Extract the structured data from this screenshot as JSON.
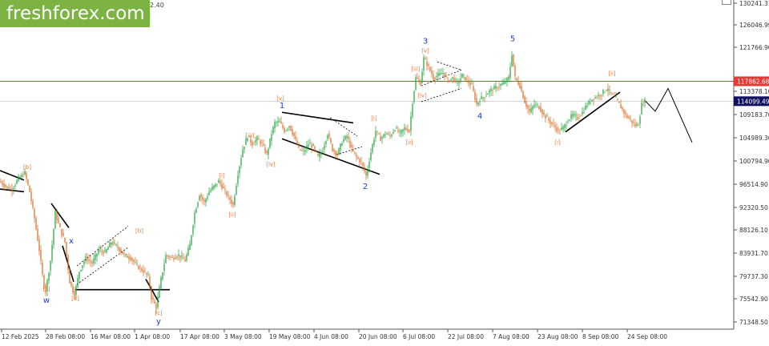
{
  "brand": {
    "logo_text": "freshforex.com",
    "color": "#7cb342"
  },
  "header_fragment": "2.40",
  "colors": {
    "up": "#1e9e3a",
    "down": "#d2691e",
    "hline": "#e53935",
    "wave_blue": "#1a3fc4",
    "wave_orange": "#e07b39",
    "axis": "#333333"
  },
  "chart_data": {
    "type": "candlestick",
    "title": "",
    "ylim": [
      71348.5,
      132000
    ],
    "y_ticks": [
      "130241.31",
      "126046.99",
      "121766.90",
      "117862.68",
      "113378.10",
      "109183.70",
      "104989.30",
      "100794.90",
      "96514.90",
      "92320.50",
      "88126.10",
      "83931.70",
      "79737.30",
      "75542.90",
      "71348.50"
    ],
    "x_ticks": [
      "12 Feb 2025",
      "28 Feb 08:00",
      "16 Mar 08:00",
      "1 Apr 08:00",
      "17 Apr 08:00",
      "3 May 08:00",
      "19 May 08:00",
      "4 Jun 08:00",
      "20 Jun 08:00",
      "6 Jul 08:00",
      "22 Jul 08:00",
      "7 Aug 08:00",
      "23 Aug 08:00",
      "8 Sep 08:00",
      "24 Sep 08:00"
    ],
    "resistance_level": {
      "value": 117862.68,
      "label": "117862.68"
    },
    "current_price": {
      "value": 114099.49,
      "label": "114099.49"
    },
    "path": [
      [
        0,
        99000
      ],
      [
        8,
        98000
      ],
      [
        16,
        97500
      ],
      [
        24,
        99500
      ],
      [
        32,
        100500
      ],
      [
        38,
        97000
      ],
      [
        44,
        92000
      ],
      [
        50,
        86000
      ],
      [
        55,
        80000
      ],
      [
        58,
        78200
      ],
      [
        64,
        84000
      ],
      [
        70,
        93000
      ],
      [
        76,
        90000
      ],
      [
        82,
        87500
      ],
      [
        88,
        80000
      ],
      [
        94,
        77500
      ],
      [
        100,
        82000
      ],
      [
        108,
        84500
      ],
      [
        116,
        83500
      ],
      [
        124,
        86000
      ],
      [
        132,
        85500
      ],
      [
        140,
        87500
      ],
      [
        148,
        86500
      ],
      [
        156,
        85000
      ],
      [
        164,
        84500
      ],
      [
        172,
        83000
      ],
      [
        180,
        82000
      ],
      [
        186,
        81000
      ],
      [
        190,
        77000
      ],
      [
        196,
        75200
      ],
      [
        202,
        80500
      ],
      [
        208,
        85000
      ],
      [
        216,
        84500
      ],
      [
        224,
        85000
      ],
      [
        232,
        84000
      ],
      [
        238,
        87000
      ],
      [
        244,
        93000
      ],
      [
        250,
        96500
      ],
      [
        256,
        95000
      ],
      [
        262,
        97000
      ],
      [
        268,
        98000
      ],
      [
        274,
        99000
      ],
      [
        280,
        97500
      ],
      [
        286,
        96000
      ],
      [
        292,
        94500
      ],
      [
        298,
        100500
      ],
      [
        304,
        105000
      ],
      [
        310,
        107500
      ],
      [
        316,
        106000
      ],
      [
        322,
        107000
      ],
      [
        328,
        106000
      ],
      [
        334,
        104000
      ],
      [
        340,
        108000
      ],
      [
        344,
        110000
      ],
      [
        350,
        110200
      ],
      [
        356,
        108500
      ],
      [
        362,
        109500
      ],
      [
        368,
        107500
      ],
      [
        374,
        105000
      ],
      [
        380,
        104500
      ],
      [
        386,
        106000
      ],
      [
        392,
        105500
      ],
      [
        398,
        103500
      ],
      [
        404,
        105000
      ],
      [
        410,
        108000
      ],
      [
        416,
        105000
      ],
      [
        422,
        104000
      ],
      [
        428,
        106500
      ],
      [
        434,
        107500
      ],
      [
        440,
        105000
      ],
      [
        446,
        103500
      ],
      [
        452,
        102500
      ],
      [
        458,
        100000
      ],
      [
        464,
        104500
      ],
      [
        470,
        108500
      ],
      [
        476,
        107000
      ],
      [
        482,
        108000
      ],
      [
        488,
        107500
      ],
      [
        494,
        109000
      ],
      [
        500,
        108000
      ],
      [
        506,
        109000
      ],
      [
        512,
        108500
      ],
      [
        516,
        114000
      ],
      [
        520,
        118500
      ],
      [
        526,
        117500
      ],
      [
        530,
        122200
      ],
      [
        536,
        120500
      ],
      [
        542,
        118500
      ],
      [
        548,
        119000
      ],
      [
        554,
        119500
      ],
      [
        560,
        118000
      ],
      [
        566,
        118500
      ],
      [
        572,
        117500
      ],
      [
        578,
        119000
      ],
      [
        584,
        118000
      ],
      [
        590,
        117000
      ],
      [
        596,
        113500
      ],
      [
        600,
        114500
      ],
      [
        606,
        115000
      ],
      [
        612,
        116000
      ],
      [
        618,
        116500
      ],
      [
        624,
        117000
      ],
      [
        630,
        117500
      ],
      [
        636,
        118500
      ],
      [
        640,
        123000
      ],
      [
        644,
        118500
      ],
      [
        650,
        117000
      ],
      [
        656,
        114000
      ],
      [
        662,
        112000
      ],
      [
        668,
        113500
      ],
      [
        674,
        113000
      ],
      [
        680,
        111500
      ],
      [
        686,
        110500
      ],
      [
        692,
        109500
      ],
      [
        698,
        108500
      ],
      [
        704,
        109000
      ],
      [
        710,
        110500
      ],
      [
        716,
        111500
      ],
      [
        722,
        111000
      ],
      [
        728,
        112000
      ],
      [
        734,
        113500
      ],
      [
        740,
        114500
      ],
      [
        746,
        115000
      ],
      [
        752,
        115500
      ],
      [
        758,
        116500
      ],
      [
        764,
        115500
      ],
      [
        770,
        114500
      ],
      [
        776,
        113000
      ],
      [
        782,
        111500
      ],
      [
        788,
        110500
      ],
      [
        794,
        109500
      ],
      [
        798,
        109800
      ],
      [
        802,
        113500
      ],
      [
        806,
        114099
      ]
    ],
    "projection": [
      [
        806,
        114099
      ],
      [
        818,
        112200
      ],
      [
        834,
        116500
      ],
      [
        864,
        106300
      ]
    ],
    "trendlines": [
      [
        [
          352,
          112000
        ],
        [
          441,
          110000
        ]
      ],
      [
        [
          352,
          107000
        ],
        [
          474,
          100300
        ]
      ],
      [
        [
          706,
          108300
        ],
        [
          774,
          115800
        ]
      ],
      [
        [
          94,
          78500
        ],
        [
          212,
          78500
        ]
      ],
      [
        [
          0,
          101000
        ],
        [
          30,
          99200
        ]
      ],
      [
        [
          0,
          97500
        ],
        [
          30,
          97000
        ]
      ],
      [
        [
          64,
          94800
        ],
        [
          86,
          90200
        ]
      ],
      [
        [
          78,
          86800
        ],
        [
          92,
          80000
        ]
      ],
      [
        [
          182,
          80500
        ],
        [
          198,
          76200
        ]
      ]
    ],
    "dashed": [
      [
        [
          96,
          83000
        ],
        [
          160,
          90500
        ]
      ],
      [
        [
          96,
          79500
        ],
        [
          160,
          86500
        ]
      ],
      [
        [
          412,
          111000
        ],
        [
          446,
          107500
        ]
      ],
      [
        [
          420,
          104000
        ],
        [
          452,
          105500
        ]
      ],
      [
        [
          526,
          117000
        ],
        [
          576,
          120000
        ]
      ],
      [
        [
          526,
          114000
        ],
        [
          576,
          116500
        ]
      ],
      [
        [
          546,
          121500
        ],
        [
          576,
          120000
        ]
      ]
    ],
    "wave_labels_blue": [
      {
        "text": "1",
        "x": 352,
        "y": 112800
      },
      {
        "text": "2",
        "x": 456,
        "y": 97500
      },
      {
        "text": "3",
        "x": 531,
        "y": 125000
      },
      {
        "text": "4",
        "x": 599,
        "y": 110800
      },
      {
        "text": "5",
        "x": 640,
        "y": 125400
      },
      {
        "text": "w",
        "x": 58,
        "y": 76000
      },
      {
        "text": "x",
        "x": 89,
        "y": 87200
      },
      {
        "text": "y",
        "x": 198,
        "y": 72000
      }
    ],
    "wave_labels_orange": [
      {
        "text": "[b]",
        "x": 34,
        "y": 101300
      },
      {
        "text": "[c]",
        "x": 58,
        "y": 78300
      },
      {
        "text": "[a]",
        "x": 94,
        "y": 76500
      },
      {
        "text": "[b]",
        "x": 174,
        "y": 89300
      },
      {
        "text": "[c]",
        "x": 198,
        "y": 73800
      },
      {
        "text": "[i]",
        "x": 277,
        "y": 99700
      },
      {
        "text": "[ii]",
        "x": 290,
        "y": 92300
      },
      {
        "text": "[iii]",
        "x": 312,
        "y": 107300
      },
      {
        "text": "[iv]",
        "x": 338,
        "y": 101800
      },
      {
        "text": "[v]",
        "x": 350,
        "y": 114300
      },
      {
        "text": "[i]",
        "x": 467,
        "y": 110500
      },
      {
        "text": "[ii]",
        "x": 511,
        "y": 106000
      },
      {
        "text": "[iii]",
        "x": 519,
        "y": 119800
      },
      {
        "text": "[iv]",
        "x": 527,
        "y": 114800
      },
      {
        "text": "[v]",
        "x": 531,
        "y": 123300
      },
      {
        "text": "[i]",
        "x": 696,
        "y": 106000
      },
      {
        "text": "[ii]",
        "x": 764,
        "y": 119000
      }
    ]
  }
}
